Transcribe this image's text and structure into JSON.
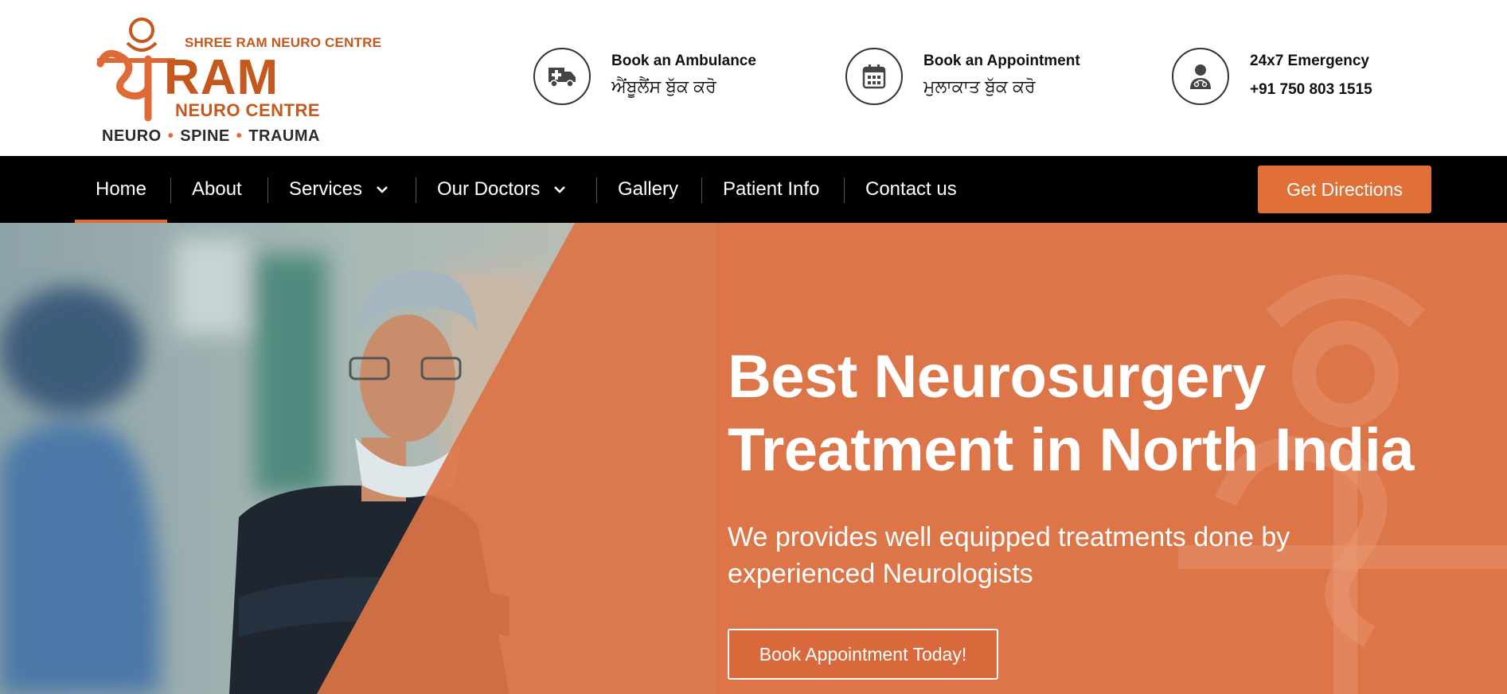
{
  "brand": {
    "logo_top": "SHREE RAM NEURO CENTRE",
    "logo_main": "RAM",
    "logo_sub": "NEURO CENTRE",
    "tag_1": "NEURO",
    "tag_2": "SPINE",
    "tag_3": "TRAUMA",
    "accent_color": "#e06a35"
  },
  "contacts": [
    {
      "icon": "ambulance-icon",
      "title": "Book an Ambulance",
      "subtitle": "ਐਂਬੂਲੈਂਸ ਬੁੱਕ ਕਰੋ"
    },
    {
      "icon": "calendar-icon",
      "title": "Book an Appointment",
      "subtitle": "ਮੁਲਾਕਾਤ ਬੁੱਕ ਕਰੋ"
    },
    {
      "icon": "doctor-icon",
      "title": "24x7 Emergency",
      "subtitle": "+91 750 803 1515"
    }
  ],
  "nav": {
    "items": [
      {
        "label": "Home",
        "active": true
      },
      {
        "label": "About"
      },
      {
        "label": "Services",
        "dropdown": true
      },
      {
        "label": "Our Doctors",
        "dropdown": true
      },
      {
        "label": "Gallery"
      },
      {
        "label": "Patient Info"
      },
      {
        "label": "Contact us"
      }
    ],
    "cta": "Get Directions"
  },
  "hero": {
    "title_line1": "Best Neurosurgery",
    "title_line2": "Treatment in North India",
    "subtitle_line1": "We provides well equipped treatments done by",
    "subtitle_line2": "experienced Neurologists",
    "button": "Book Appointment Today!"
  }
}
